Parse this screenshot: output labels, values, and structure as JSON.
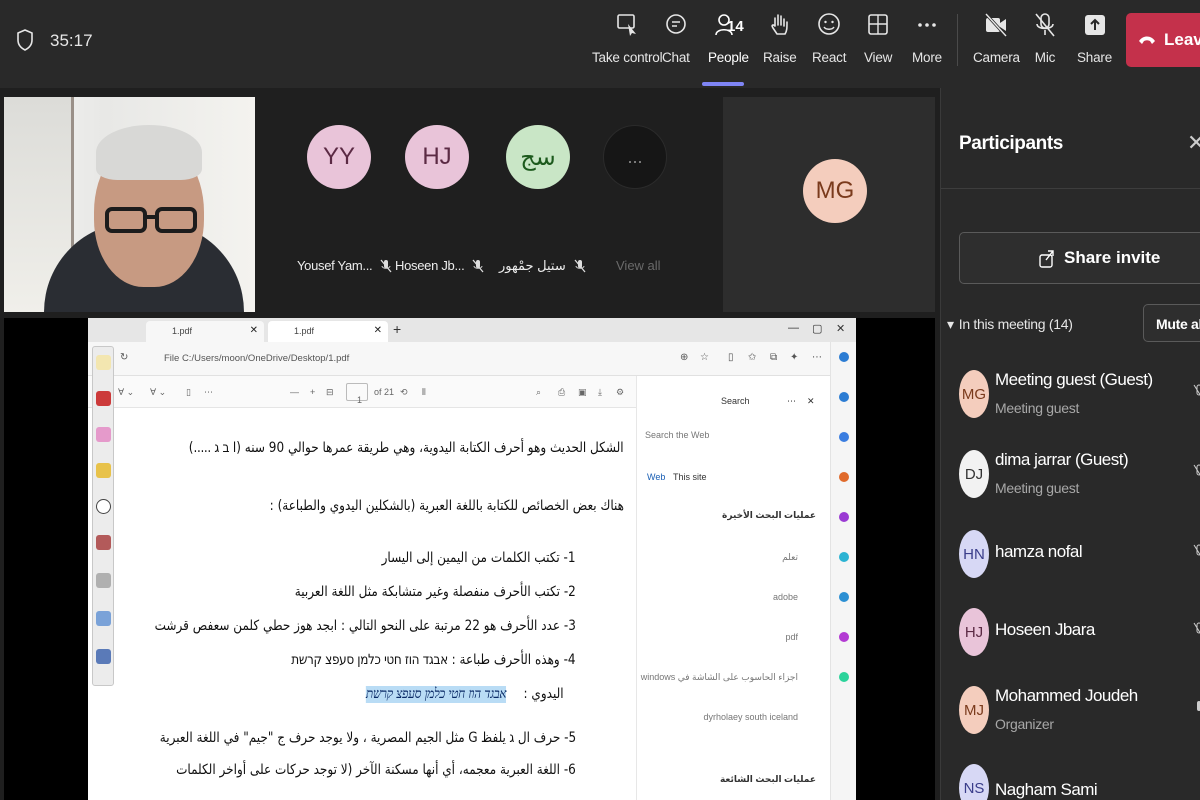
{
  "meeting": {
    "timer": "35:17",
    "people_count": "14"
  },
  "toolbar": {
    "items": [
      {
        "label": "Take control",
        "icon": "take-control-icon"
      },
      {
        "label": "Chat",
        "icon": "chat-icon"
      },
      {
        "label": "People",
        "icon": "people-icon",
        "active": true
      },
      {
        "label": "Raise",
        "icon": "raise-hand-icon"
      },
      {
        "label": "React",
        "icon": "react-icon"
      },
      {
        "label": "View",
        "icon": "view-icon"
      },
      {
        "label": "More",
        "icon": "more-icon"
      },
      {
        "label": "Camera",
        "icon": "camera-off-icon"
      },
      {
        "label": "Mic",
        "icon": "mic-off-icon"
      },
      {
        "label": "Share",
        "icon": "share-icon"
      }
    ],
    "leave_label": "Leave",
    "leave_color": "#c4314b",
    "accent": "#7f85f5"
  },
  "tiles": [
    {
      "initials": "YY",
      "name": "Yousef Yam...",
      "color": "#e9c4d9"
    },
    {
      "initials": "HJ",
      "name": "Hoseen Jb...",
      "color": "#e9c4d9"
    },
    {
      "initials": "سج",
      "name": "ستيل جمْهور",
      "color": "#c9e6c6"
    }
  ],
  "view_all": {
    "label": "View all",
    "dots": "..."
  },
  "big_tile": {
    "initials": "MG"
  },
  "screen": {
    "tab1": "1.pdf",
    "tab2": "1.pdf",
    "address": "File   C:/Users/moon/OneDrive/Desktop/1.pdf",
    "page_number": "1",
    "page_total": "of 21",
    "doc_lines": [
      "الشكل الحديث وهو أحرف الكتابة اليدوية، وهي طريقة عمرها حوالي 90 سنه (ا ב ג .....)",
      "هناك بعض الخصائص للكتابة باللغة العبرية (بالشكلين اليدوي والطباعة) :",
      "1- تكتب الكلمات من اليمين إلى اليسار",
      "2- تكتب الأحرف منفصلة وغير متشابكة مثل اللغة العربية",
      "3- عدد الأحرف هو 22 مرتبة على النحو التالي : ابجد هوز حطي كلمن سعفص قرشت",
      "4- وهذه الأحرف طباعة : אבגד הוז חטי כלמן סעפצ קרשת",
      "اليدوي :",
      "אבגד הוז חטי כלמן סעפצ קרשת",
      "5- حرف ال ג يلفظ G مثل الجيم المصرية ، ولا يوجد حرف ج \"جيم\" في اللغة العبرية",
      "6- اللغة العبرية معجمه، أي أنها مسكنة الآخر (لا توجد حركات على أواخر الكلمات"
    ],
    "search_pane": {
      "title": "Search",
      "placeholder": "Search the Web",
      "tab_web": "Web",
      "tab_site": "This site",
      "recent_header": "عمليات البحث الأخيرة",
      "recent": [
        "تعلم",
        "adobe",
        "pdf",
        "اجزاء الحاسوب على الشاشة في windows",
        "dyrholaey south iceland"
      ],
      "trending_header": "عمليات البحث الشائعة"
    }
  },
  "participants": {
    "title": "Participants",
    "share_invite": "Share invite",
    "section": "In this meeting (14)",
    "mute_all": "Mute all",
    "people": [
      {
        "initials": "MG",
        "name": "Meeting guest (Guest)",
        "role": "Meeting guest",
        "color": "#f4cdbd",
        "text": "#7a3a1c"
      },
      {
        "initials": "DJ",
        "name": "dima jarrar (Guest)",
        "role": "Meeting guest",
        "color": "#f2f2f2",
        "text": "#333333"
      },
      {
        "initials": "HN",
        "name": "hamza nofal",
        "role": "",
        "color": "#d7d8f5",
        "text": "#3a3d8a"
      },
      {
        "initials": "HJ",
        "name": "Hoseen Jbara",
        "role": "",
        "color": "#e9c4d9",
        "text": "#5b2a44"
      },
      {
        "initials": "MJ",
        "name": "Mohammed Joudeh",
        "role": "Organizer",
        "color": "#f4cdbd",
        "text": "#7a3a1c"
      },
      {
        "initials": "NS",
        "name": "Nagham Sami",
        "role": "",
        "color": "#d7d8f5",
        "text": "#3a3d8a"
      }
    ]
  }
}
